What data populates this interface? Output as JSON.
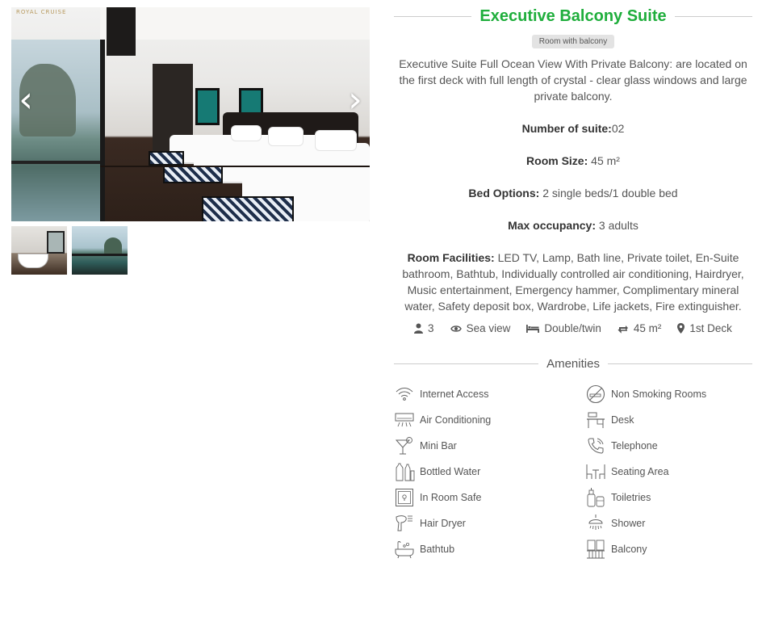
{
  "gallery": {
    "prev_glyph": "‹",
    "next_glyph": "›",
    "logo_text": "ROYAL CRUISE"
  },
  "room": {
    "title": "Executive Balcony Suite",
    "badge": "Room with balcony",
    "title_color": "#1fae3c"
  },
  "description": {
    "line1": "Executive Suite Full Ocean View With Private Balcony: are located on the first deck with full length of crystal - clear glass windows and large",
    "line2": "private balcony.",
    "suite_label": "Number of suite:",
    "suite_value": "02",
    "size_label": "Room Size:",
    "size_value": " 45 m²",
    "bed_label": "Bed Options:",
    "bed_value": " 2 single beds/1 double bed",
    "occ_label": "Max occupancy:",
    "occ_value": " 3 adults",
    "facilities_label": "Room Facilities:",
    "facilities_value": " LED TV, Lamp, Bath line, Private toilet, En-Suite bathroom, Bathtub, Individually controlled air conditioning, Hairdryer, Music entertainment, Emergency hammer, Complimentary mineral water, Safety deposit box, Wardrobe, Life jackets, Fire extinguisher."
  },
  "specs": [
    {
      "icon": "user-icon",
      "text": "3"
    },
    {
      "icon": "eye-icon",
      "text": "Sea view"
    },
    {
      "icon": "bed-icon",
      "text": "Double/twin"
    },
    {
      "icon": "resize-icon",
      "text": "45 m²"
    },
    {
      "icon": "map-marker-icon",
      "text": "1st Deck"
    }
  ],
  "amenities": {
    "title": "Amenities",
    "left": [
      {
        "icon": "wifi-icon",
        "label": "Internet Access"
      },
      {
        "icon": "air-conditioner-icon",
        "label": "Air Conditioning"
      },
      {
        "icon": "cocktail-icon",
        "label": "Mini Bar"
      },
      {
        "icon": "bottles-icon",
        "label": "Bottled Water"
      },
      {
        "icon": "safe-icon",
        "label": "In Room Safe"
      },
      {
        "icon": "hair-dryer-icon",
        "label": "Hair Dryer"
      },
      {
        "icon": "bathtub-icon",
        "label": "Bathtub"
      }
    ],
    "right": [
      {
        "icon": "no-smoking-icon",
        "label": "Non Smoking Rooms"
      },
      {
        "icon": "desk-icon",
        "label": "Desk"
      },
      {
        "icon": "telephone-icon",
        "label": "Telephone"
      },
      {
        "icon": "seating-icon",
        "label": "Seating Area"
      },
      {
        "icon": "toiletries-icon",
        "label": "Toiletries"
      },
      {
        "icon": "shower-icon",
        "label": "Shower"
      },
      {
        "icon": "balcony-icon",
        "label": "Balcony"
      }
    ]
  }
}
